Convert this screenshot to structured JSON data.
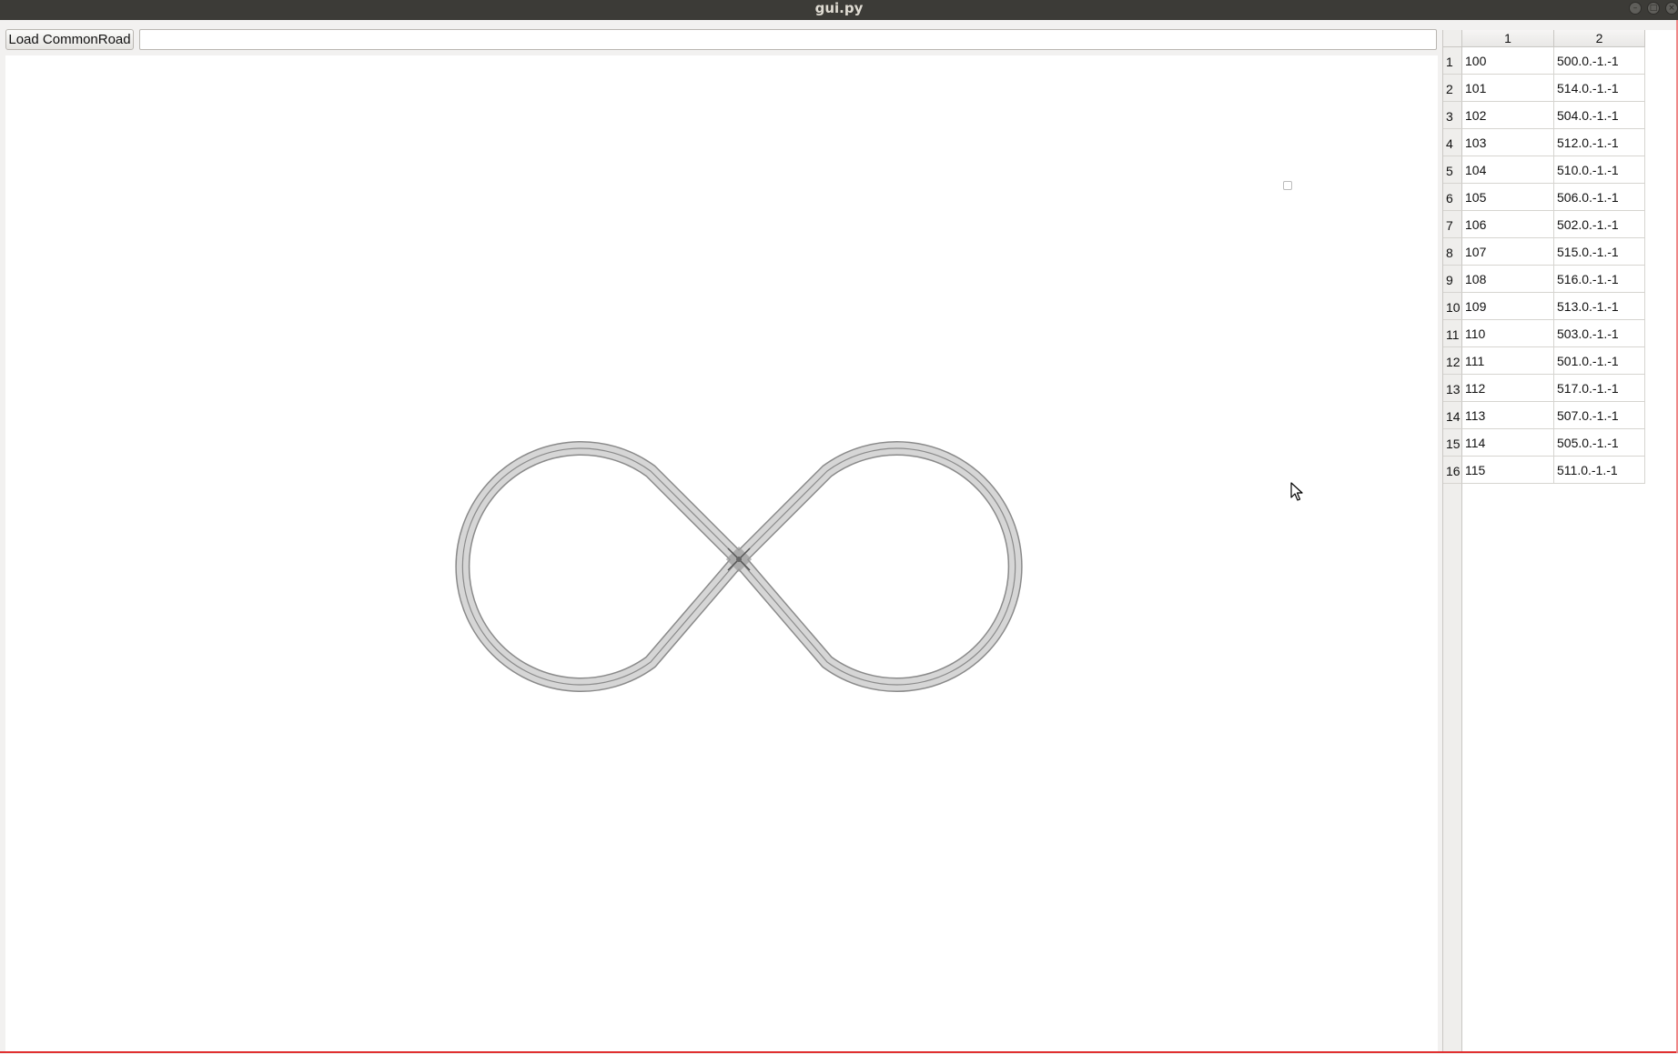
{
  "window": {
    "title": "gui.py"
  },
  "toolbar": {
    "load_button": "Load CommonRoad",
    "path_input_value": "",
    "path_input_placeholder": ""
  },
  "canvas": {
    "description_shape": "figure-eight road network",
    "road_color": "#d3d3d3",
    "road_edge_color": "#808080"
  },
  "table": {
    "columns": [
      "1",
      "2"
    ],
    "rows": [
      {
        "index": "1",
        "col1": "100",
        "col2": "500.0.-1.-1"
      },
      {
        "index": "2",
        "col1": "101",
        "col2": "514.0.-1.-1"
      },
      {
        "index": "3",
        "col1": "102",
        "col2": "504.0.-1.-1"
      },
      {
        "index": "4",
        "col1": "103",
        "col2": "512.0.-1.-1"
      },
      {
        "index": "5",
        "col1": "104",
        "col2": "510.0.-1.-1"
      },
      {
        "index": "6",
        "col1": "105",
        "col2": "506.0.-1.-1"
      },
      {
        "index": "7",
        "col1": "106",
        "col2": "502.0.-1.-1"
      },
      {
        "index": "8",
        "col1": "107",
        "col2": "515.0.-1.-1"
      },
      {
        "index": "9",
        "col1": "108",
        "col2": "516.0.-1.-1"
      },
      {
        "index": "10",
        "col1": "109",
        "col2": "513.0.-1.-1"
      },
      {
        "index": "11",
        "col1": "110",
        "col2": "503.0.-1.-1"
      },
      {
        "index": "12",
        "col1": "111",
        "col2": "501.0.-1.-1"
      },
      {
        "index": "13",
        "col1": "112",
        "col2": "517.0.-1.-1"
      },
      {
        "index": "14",
        "col1": "113",
        "col2": "507.0.-1.-1"
      },
      {
        "index": "15",
        "col1": "114",
        "col2": "505.0.-1.-1"
      },
      {
        "index": "16",
        "col1": "115",
        "col2": "511.0.-1.-1"
      }
    ]
  },
  "icons": {
    "minimize": "minimize-icon",
    "maximize": "maximize-icon",
    "close": "close-icon",
    "cursor": "mouse-pointer-icon"
  }
}
